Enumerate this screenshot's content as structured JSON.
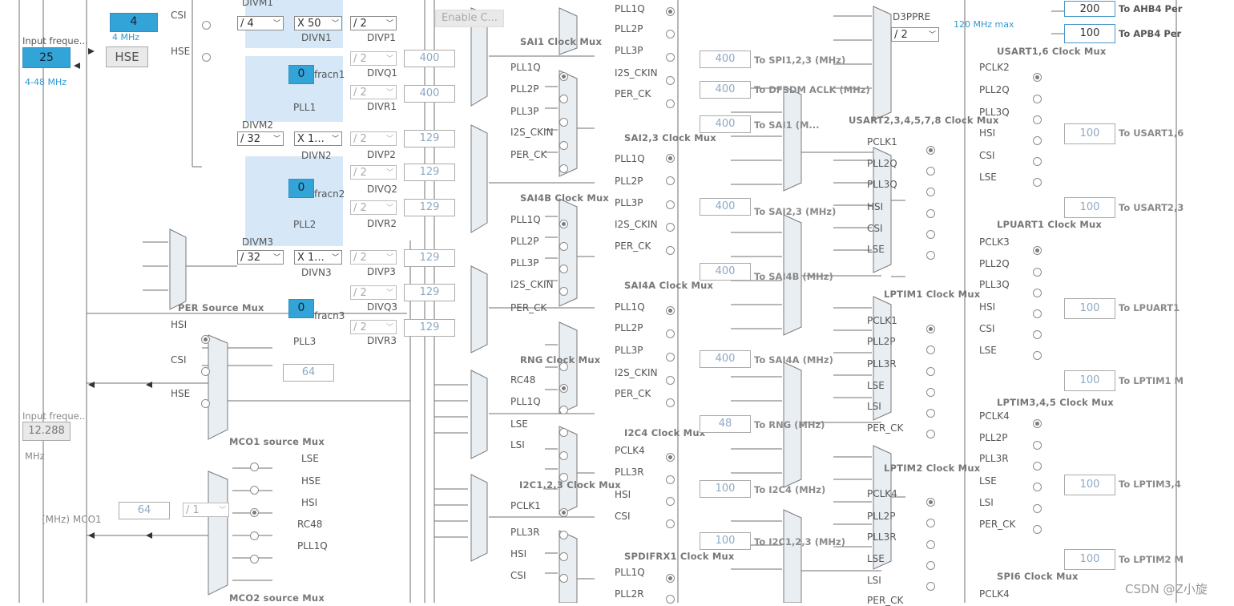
{
  "left": {
    "csi_label": "CSI",
    "hse_label": "HSE",
    "input_freq_label": "Input freque...",
    "input_freq_value": "25",
    "input_range": "4-48 MHz",
    "hse_button": "HSE",
    "csi_value": "4",
    "csi_freq": "4 MHz",
    "input_freq2_label": "Input freque...",
    "input_freq2_value": "12.288",
    "mhz": "MHz",
    "mco1_label": "(MHz) MCO1",
    "mco1_value": "64",
    "mco1_div": "/ 1"
  },
  "pll": {
    "divm1_label": "DIVM1",
    "divm2_label": "DIVM2",
    "divm3_label": "DIVM3",
    "divm1": "/ 4",
    "divm2": "/ 32",
    "divm3": "/ 32",
    "divn1": "X 50",
    "divn2": "X 1...",
    "divn3": "X 1...",
    "divn1_label": "DIVN1",
    "divn2_label": "DIVN2",
    "divn3_label": "DIVN3",
    "pll1_label": "PLL1",
    "pll2_label": "PLL2",
    "pll3_label": "PLL3",
    "fracn1_label": "fracn1",
    "fracn2_label": "fracn2",
    "fracn3_label": "fracn3",
    "fracn_value": "0",
    "div2": "/ 2",
    "divp1": "DIVP1",
    "divq1": "DIVQ1",
    "divr1": "DIVR1",
    "divp2": "DIVP2",
    "divq2": "DIVQ2",
    "divr2": "DIVR2",
    "divp3": "DIVP3",
    "divq3": "DIVQ3",
    "divr3": "DIVR3",
    "out_p1": "",
    "out_q1": "400",
    "out_r1": "400",
    "out_p2": "129",
    "out_q2": "129",
    "out_r2": "129",
    "out_p3": "129",
    "out_q3": "129",
    "out_r3": "129",
    "enable_btn": "Enable C..."
  },
  "per_mux": {
    "title": "PER Source Mux",
    "opts": [
      "HSI",
      "CSI",
      "HSE"
    ],
    "out": "64",
    "pll3": "PLL3"
  },
  "mco1_mux": {
    "title": "MCO1 source Mux"
  },
  "mco2_mux": {
    "title": "MCO2 source Mux",
    "opts": [
      "LSE",
      "HSE",
      "HSI",
      "RC48",
      "PLL1Q"
    ]
  },
  "col2": {
    "sai1_title": "SAI1 Clock Mux",
    "sai1_opts": [
      "PLL1Q",
      "PLL2P",
      "PLL3P",
      "I2S_CKIN",
      "PER_CK"
    ],
    "sai4b_title": "SAI4B Clock Mux",
    "sai4b_opts": [
      "PLL1Q",
      "PLL2P",
      "PLL3P",
      "I2S_CKIN",
      "PER_CK"
    ],
    "rng_title": "RNG Clock Mux",
    "rng_opts": [
      "RC48",
      "PLL1Q",
      "LSE",
      "LSI"
    ],
    "i2c123_title": "I2C1,2,3 Clock Mux",
    "i2c123_opts": [
      "PCLK1",
      "PLL3R",
      "HSI",
      "CSI"
    ]
  },
  "col3": {
    "top_opts": [
      "PLL1Q",
      "PLL2P",
      "PLL3P",
      "I2S_CKIN",
      "PER_CK"
    ],
    "sai23_title": "SAI2,3 Clock Mux",
    "sai23_opts": [
      "PLL1Q",
      "PLL2P",
      "PLL3P",
      "I2S_CKIN",
      "PER_CK"
    ],
    "sai4a_title": "SAI4A Clock Mux",
    "sai4a_opts": [
      "PLL1Q",
      "PLL2P",
      "PLL3P",
      "I2S_CKIN",
      "PER_CK"
    ],
    "i2c4_title": "I2C4 Clock Mux",
    "i2c4_opts": [
      "PCLK4",
      "PLL3R",
      "HSI",
      "CSI"
    ],
    "spdif_title": "SPDIFRX1 Clock Mux",
    "spdif_opts": [
      "PLL1Q",
      "PLL2R"
    ]
  },
  "outputs": {
    "spi": {
      "value": "400",
      "label": "To SPI1,2,3 (MHz)"
    },
    "dfsdm": {
      "value": "400",
      "label": "To DFSDM ACLK (MHz)"
    },
    "sai1": {
      "value": "400",
      "label": "To SAI1 (M..."
    },
    "sai23": {
      "value": "400",
      "label": "To SAI2,3 (MHz)"
    },
    "sai4b": {
      "value": "400",
      "label": "To SAI4B (MHz)"
    },
    "sai4a": {
      "value": "400",
      "label": "To SAI4A (MHz)"
    },
    "rng": {
      "value": "48",
      "label": "To RNG (MHz)"
    },
    "i2c4": {
      "value": "100",
      "label": "To I2C4 (MHz)"
    },
    "i2c123": {
      "value": "100",
      "label": "To I2C1,2,3 (MHz)"
    }
  },
  "col4": {
    "d3ppre_label": "D3PPRE",
    "d3ppre_value": "/ 2",
    "max_label": "120 MHz max",
    "usart16_title": "USART1,6 Clock Mux",
    "usart16_opts": [
      "PCLK2",
      "PLL2Q",
      "PLL3Q",
      "HSI",
      "CSI",
      "LSE"
    ],
    "usart2_title": "USART2,3,4,5,7,8 Clock Mux",
    "usart2_opts": [
      "PCLK1",
      "PLL2Q",
      "PLL3Q",
      "HSI",
      "CSI",
      "LSE"
    ],
    "lpuart_title": "LPUART1 Clock Mux",
    "lpuart_opts": [
      "PCLK3",
      "PLL2Q",
      "PLL3Q",
      "HSI",
      "CSI",
      "LSE"
    ],
    "lptim1_title": "LPTIM1 Clock Mux",
    "lptim1_opts": [
      "PCLK1",
      "PLL2P",
      "PLL3R",
      "LSE",
      "LSI",
      "PER_CK"
    ],
    "lptim345_title": "LPTIM3,4,5 Clock Mux",
    "lptim345_opts": [
      "PCLK4",
      "PLL2P",
      "PLL3R",
      "LSE",
      "LSI",
      "PER_CK"
    ],
    "lptim2_title": "LPTIM2 Clock Mux",
    "lptim2_opts": [
      "PCLK4",
      "PLL2P",
      "PLL3R",
      "LSE",
      "LSI",
      "PER_CK"
    ],
    "spi6_title": "SPI6 Clock Mux",
    "spi6_opts": [
      "PCLK4"
    ]
  },
  "right_out": {
    "ahb4": {
      "value": "200",
      "label": "To AHB4 Per"
    },
    "apb4": {
      "value": "100",
      "label": "To APB4 Per"
    },
    "usart16": {
      "value": "100",
      "label": "To USART1,6"
    },
    "usart2": {
      "value": "100",
      "label": "To USART2,3"
    },
    "lpuart": {
      "value": "100",
      "label": "To LPUART1"
    },
    "lptim1": {
      "value": "100",
      "label": "To LPTIM1 M"
    },
    "lptim3": {
      "value": "100",
      "label": "To LPTIM3,4"
    },
    "lptim2": {
      "value": "100",
      "label": "To LPTIM2 M"
    }
  },
  "watermark": "CSDN @Z小旋"
}
